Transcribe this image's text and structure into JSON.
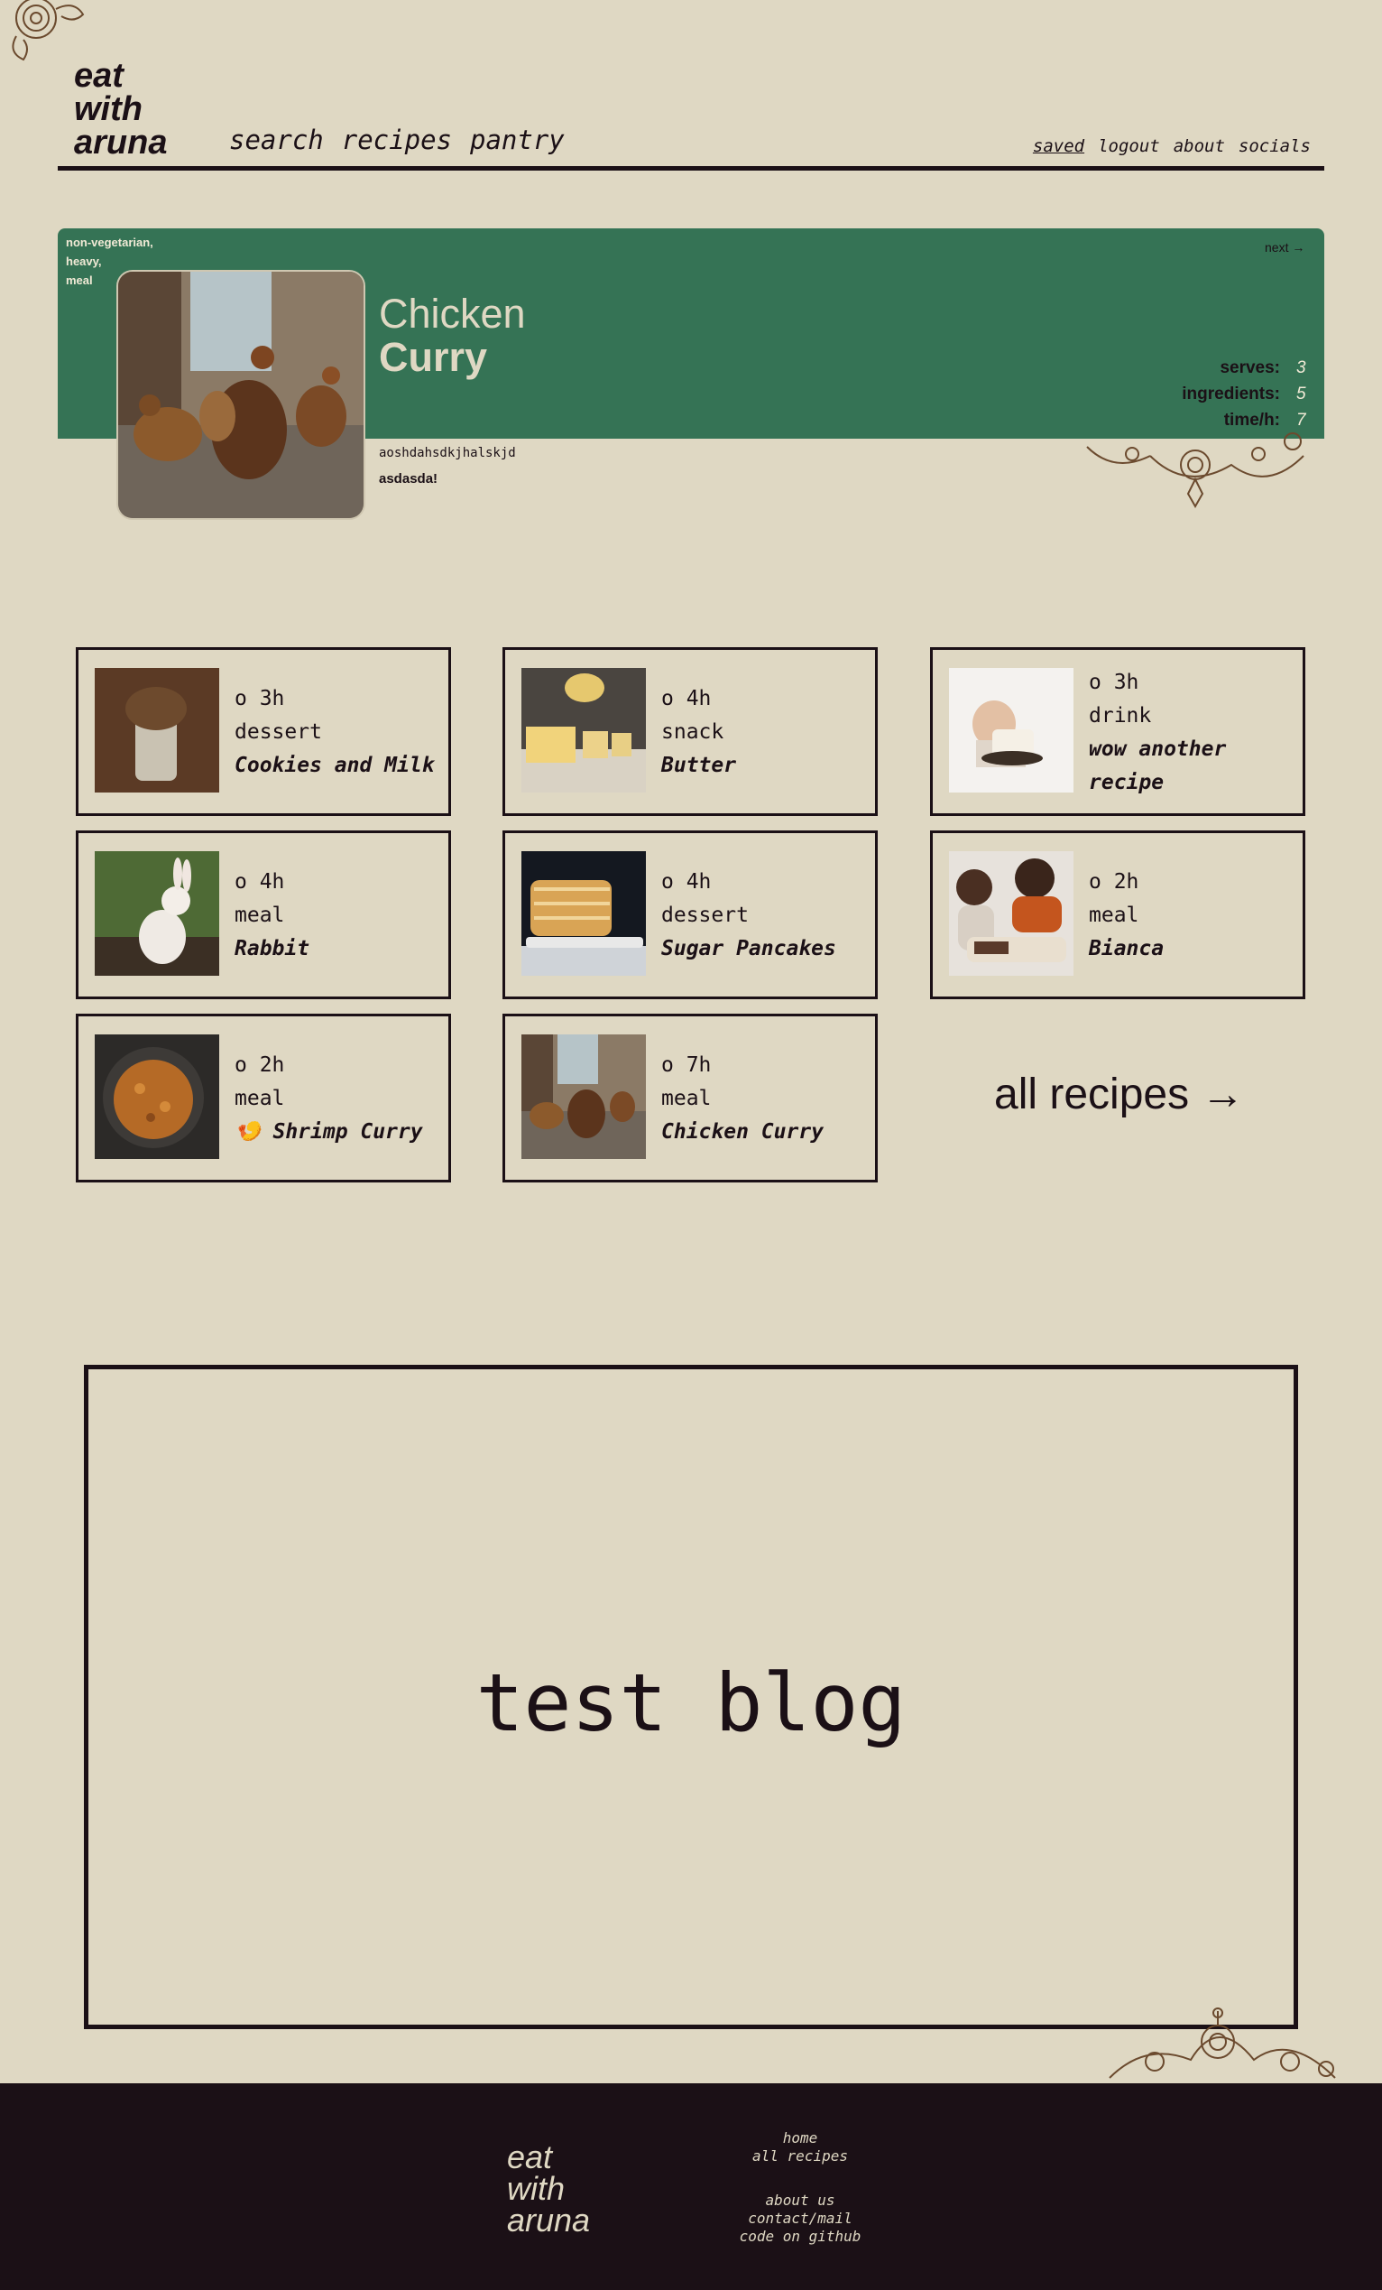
{
  "header": {
    "logo": [
      "eat",
      "with",
      "aruna"
    ],
    "nav": [
      "search",
      "recipes",
      "pantry"
    ],
    "subnav": [
      "saved",
      "logout",
      "about",
      "socials"
    ]
  },
  "hero": {
    "tags": [
      "non-vegetarian,",
      "heavy,",
      "meal"
    ],
    "next": "next →",
    "title_line1": "Chicken",
    "title_line2": "Curry",
    "stats": [
      {
        "label": "serves:",
        "value": "3"
      },
      {
        "label": "ingredients:",
        "value": "5"
      },
      {
        "label": "time/h:",
        "value": "7"
      }
    ],
    "desc1": "aoshdahsdkjhalskjd",
    "desc2": "asdasda!"
  },
  "recipes": [
    {
      "time": "o 3h",
      "type": "dessert",
      "name": "Cookies and Milk"
    },
    {
      "time": "o 4h",
      "type": "snack",
      "name": "Butter"
    },
    {
      "time": "o 3h",
      "type": "drink",
      "name": "wow another\nrecipe"
    },
    {
      "time": "o 4h",
      "type": "meal",
      "name": "Rabbit"
    },
    {
      "time": "o 4h",
      "type": "dessert",
      "name": "Sugar Pancakes"
    },
    {
      "time": "o 2h",
      "type": "meal",
      "name": "Bianca"
    },
    {
      "time": "o 2h",
      "type": "meal",
      "name": "🍤 Shrimp Curry"
    },
    {
      "time": "o 7h",
      "type": "meal",
      "name": "Chicken Curry"
    }
  ],
  "all_recipes": "all recipes →",
  "blog": {
    "title": "test blog"
  },
  "footer": {
    "logo": [
      "eat",
      "with",
      "aruna"
    ],
    "links1": [
      "home",
      "all recipes"
    ],
    "links2": [
      "about us",
      "contact/mail",
      "code on github"
    ]
  },
  "colors": {
    "background": "#dfd8c3",
    "ink": "#1b1016",
    "hero_green": "#357355"
  }
}
